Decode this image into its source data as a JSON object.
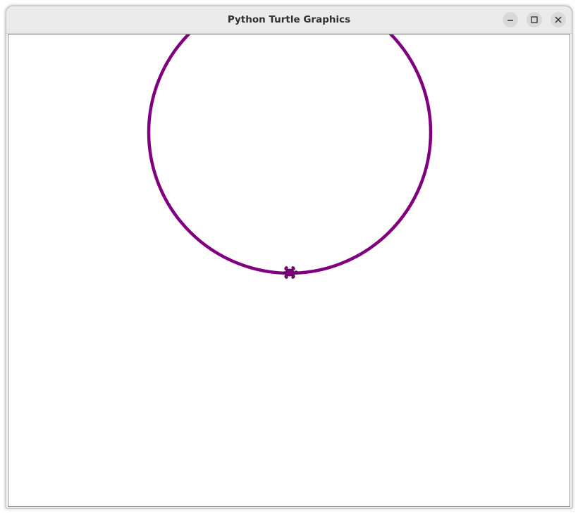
{
  "window": {
    "title": "Python Turtle Graphics"
  },
  "titlebar": {
    "buttons": [
      {
        "name": "minimize",
        "icon": "minimize-icon"
      },
      {
        "name": "maximize",
        "icon": "maximize-icon"
      },
      {
        "name": "close",
        "icon": "close-icon"
      }
    ]
  },
  "canvas": {
    "background": "#ffffff",
    "shapes": [
      {
        "type": "circle",
        "stroke": "#800080"
      }
    ],
    "turtle": {
      "shape": "turtle",
      "color": "#800080"
    }
  }
}
